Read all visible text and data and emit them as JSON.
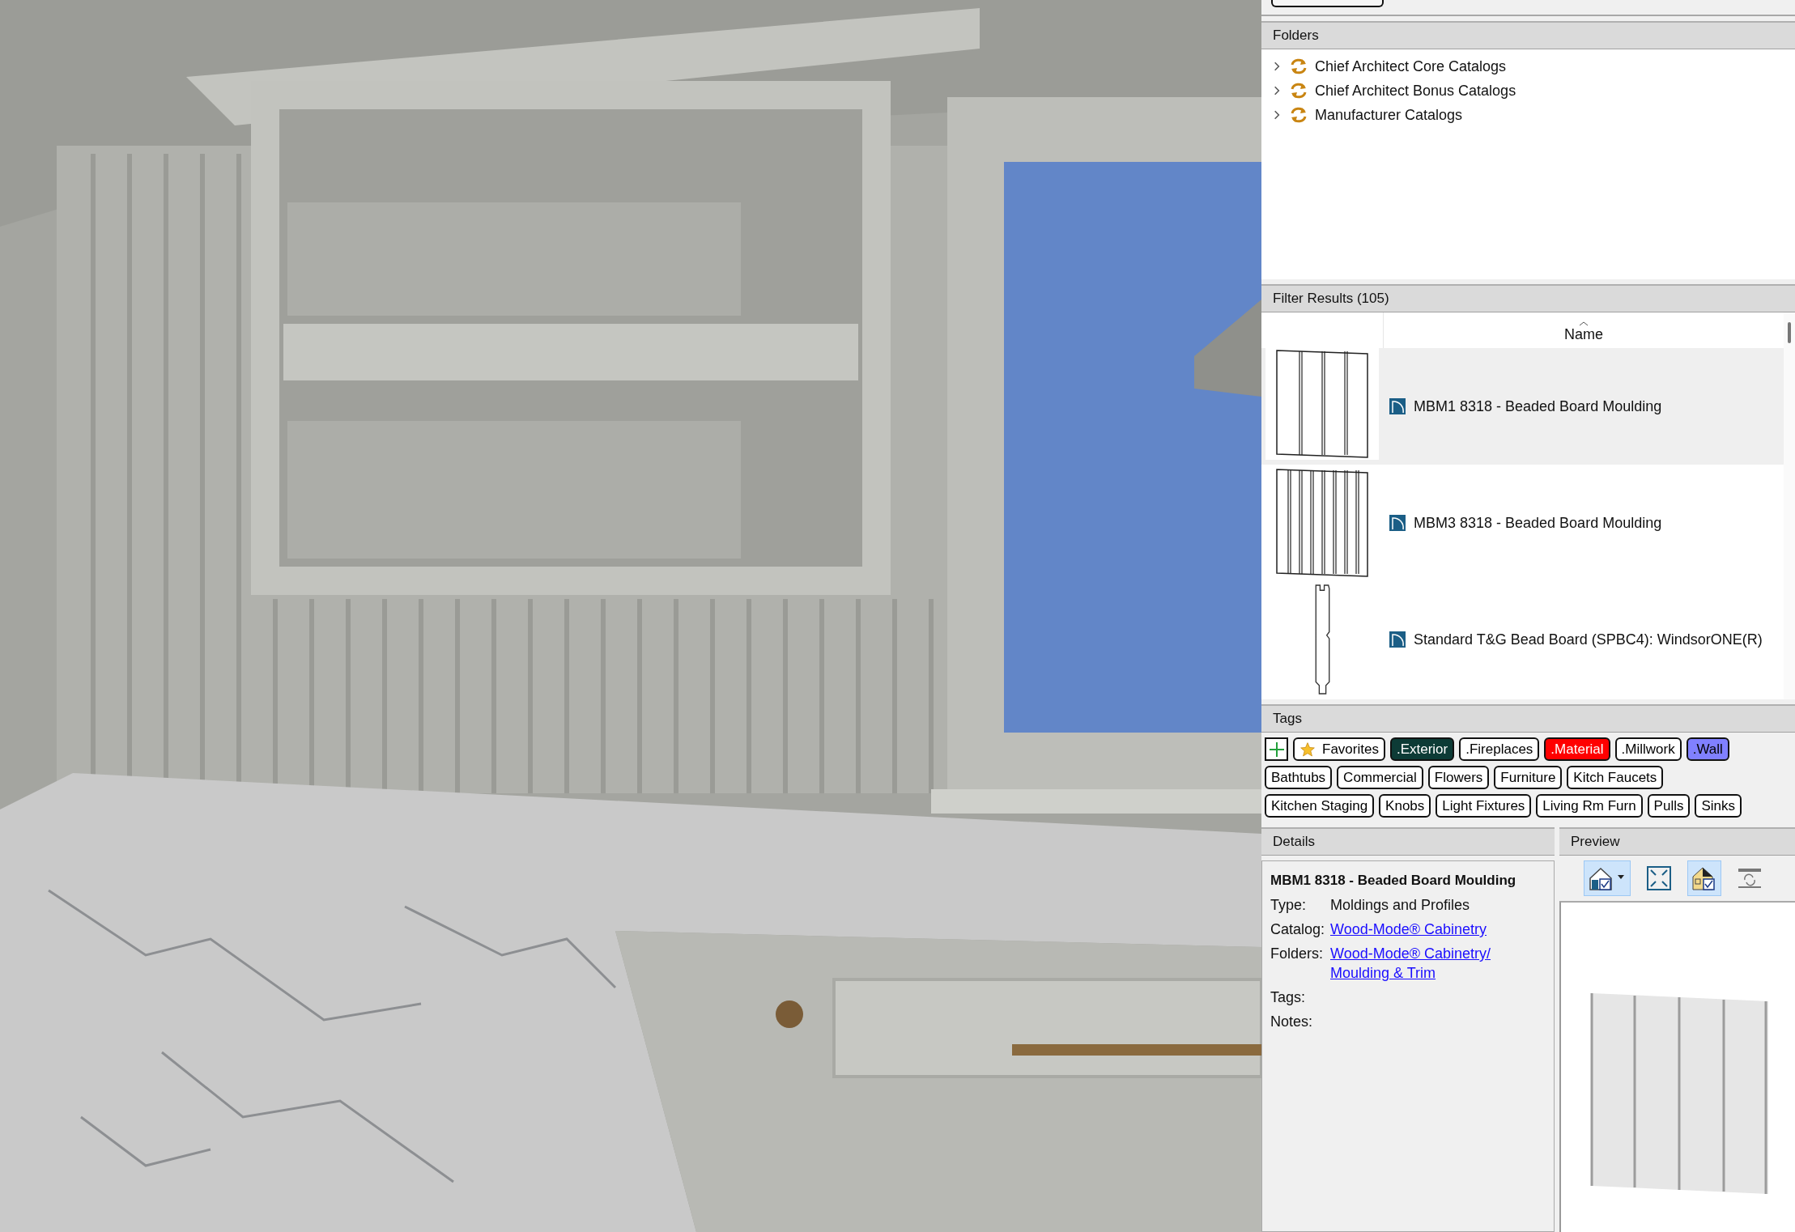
{
  "folders": {
    "title": "Folders",
    "items": [
      {
        "label": "Chief Architect Core Catalogs",
        "expanded": false
      },
      {
        "label": "Chief Architect Bonus Catalogs",
        "expanded": false
      },
      {
        "label": "Manufacturer Catalogs",
        "expanded": false
      }
    ]
  },
  "results": {
    "title": "Filter Results (105)",
    "column": "Name",
    "rows": [
      {
        "name": "MBM1 8318 - Beaded Board Moulding",
        "kind": "board4",
        "selected": true
      },
      {
        "name": "MBM3 8318 - Beaded Board Moulding",
        "kind": "board8",
        "selected": false
      },
      {
        "name": "Standard T&G Bead Board (SPBC4): WindsorONE(R)",
        "kind": "profile",
        "selected": false
      }
    ]
  },
  "tags": {
    "title": "Tags",
    "items": [
      {
        "kind": "add"
      },
      {
        "kind": "favorite",
        "label": "Favorites"
      },
      {
        "kind": "tag",
        "label": ".Exterior",
        "color": "#0d3b36"
      },
      {
        "kind": "tag",
        "label": ".Fireplaces",
        "color": "#ffffff"
      },
      {
        "kind": "tag",
        "label": ".Material",
        "color": "#ff0000"
      },
      {
        "kind": "tag",
        "label": ".Millwork",
        "color": "#ffffff"
      },
      {
        "kind": "tag",
        "label": ".Wall",
        "color": "#8080ff"
      },
      {
        "kind": "tag",
        "label": "Bathtubs",
        "color": "#ffffff"
      },
      {
        "kind": "tag",
        "label": "Commercial",
        "color": "#ffffff"
      },
      {
        "kind": "tag",
        "label": "Flowers",
        "color": "#ffffff"
      },
      {
        "kind": "tag",
        "label": "Furniture",
        "color": "#ffffff"
      },
      {
        "kind": "tag",
        "label": "Kitch Faucets",
        "color": "#ffffff"
      },
      {
        "kind": "tag",
        "label": "Kitchen Staging",
        "color": "#ffffff"
      },
      {
        "kind": "tag",
        "label": "Knobs",
        "color": "#ffffff"
      },
      {
        "kind": "tag",
        "label": "Light Fixtures",
        "color": "#ffffff"
      },
      {
        "kind": "tag",
        "label": "Living Rm Furn",
        "color": "#ffffff"
      },
      {
        "kind": "tag",
        "label": "Pulls",
        "color": "#ffffff"
      },
      {
        "kind": "tag",
        "label": "Sinks",
        "color": "#ffffff"
      }
    ]
  },
  "details": {
    "title": "Details",
    "name": "MBM1 8318 - Beaded Board Moulding",
    "fields": [
      {
        "label": "Type:",
        "kind": "text",
        "values": [
          "Moldings and Profiles"
        ]
      },
      {
        "label": "Catalog:",
        "kind": "link",
        "values": [
          "Wood-Mode® Cabinetry"
        ]
      },
      {
        "label": "Folders:",
        "kind": "link",
        "values": [
          "Wood-Mode® Cabinetry/",
          "Moulding & Trim"
        ]
      },
      {
        "label": "Tags:"
      },
      {
        "label": "Notes:"
      }
    ]
  },
  "preview": {
    "title": "Preview",
    "tools": [
      {
        "kind": "camera",
        "selected": true
      },
      {
        "kind": "fit",
        "selected": false
      },
      {
        "kind": "material",
        "selected": true
      },
      {
        "kind": "refresh",
        "selected": false
      }
    ]
  }
}
